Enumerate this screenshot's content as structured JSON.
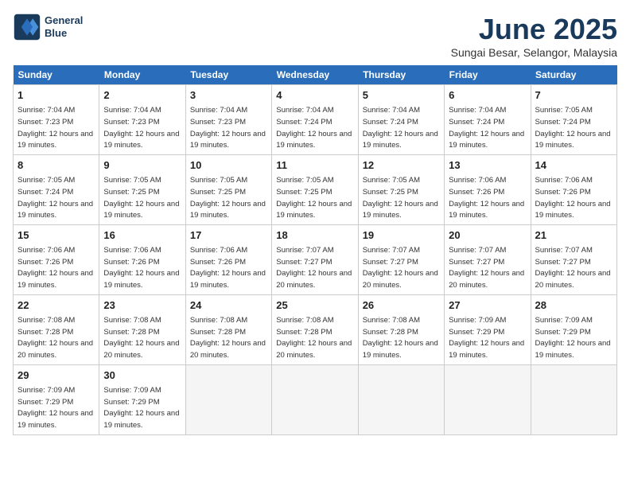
{
  "logo": {
    "line1": "General",
    "line2": "Blue"
  },
  "title": "June 2025",
  "subtitle": "Sungai Besar, Selangor, Malaysia",
  "headers": [
    "Sunday",
    "Monday",
    "Tuesday",
    "Wednesday",
    "Thursday",
    "Friday",
    "Saturday"
  ],
  "weeks": [
    [
      {
        "day": "1",
        "sunrise": "7:04 AM",
        "sunset": "7:23 PM",
        "daylight": "12 hours and 19 minutes."
      },
      {
        "day": "2",
        "sunrise": "7:04 AM",
        "sunset": "7:23 PM",
        "daylight": "12 hours and 19 minutes."
      },
      {
        "day": "3",
        "sunrise": "7:04 AM",
        "sunset": "7:23 PM",
        "daylight": "12 hours and 19 minutes."
      },
      {
        "day": "4",
        "sunrise": "7:04 AM",
        "sunset": "7:24 PM",
        "daylight": "12 hours and 19 minutes."
      },
      {
        "day": "5",
        "sunrise": "7:04 AM",
        "sunset": "7:24 PM",
        "daylight": "12 hours and 19 minutes."
      },
      {
        "day": "6",
        "sunrise": "7:04 AM",
        "sunset": "7:24 PM",
        "daylight": "12 hours and 19 minutes."
      },
      {
        "day": "7",
        "sunrise": "7:05 AM",
        "sunset": "7:24 PM",
        "daylight": "12 hours and 19 minutes."
      }
    ],
    [
      {
        "day": "8",
        "sunrise": "7:05 AM",
        "sunset": "7:24 PM",
        "daylight": "12 hours and 19 minutes."
      },
      {
        "day": "9",
        "sunrise": "7:05 AM",
        "sunset": "7:25 PM",
        "daylight": "12 hours and 19 minutes."
      },
      {
        "day": "10",
        "sunrise": "7:05 AM",
        "sunset": "7:25 PM",
        "daylight": "12 hours and 19 minutes."
      },
      {
        "day": "11",
        "sunrise": "7:05 AM",
        "sunset": "7:25 PM",
        "daylight": "12 hours and 19 minutes."
      },
      {
        "day": "12",
        "sunrise": "7:05 AM",
        "sunset": "7:25 PM",
        "daylight": "12 hours and 19 minutes."
      },
      {
        "day": "13",
        "sunrise": "7:06 AM",
        "sunset": "7:26 PM",
        "daylight": "12 hours and 19 minutes."
      },
      {
        "day": "14",
        "sunrise": "7:06 AM",
        "sunset": "7:26 PM",
        "daylight": "12 hours and 19 minutes."
      }
    ],
    [
      {
        "day": "15",
        "sunrise": "7:06 AM",
        "sunset": "7:26 PM",
        "daylight": "12 hours and 19 minutes."
      },
      {
        "day": "16",
        "sunrise": "7:06 AM",
        "sunset": "7:26 PM",
        "daylight": "12 hours and 19 minutes."
      },
      {
        "day": "17",
        "sunrise": "7:06 AM",
        "sunset": "7:26 PM",
        "daylight": "12 hours and 19 minutes."
      },
      {
        "day": "18",
        "sunrise": "7:07 AM",
        "sunset": "7:27 PM",
        "daylight": "12 hours and 20 minutes."
      },
      {
        "day": "19",
        "sunrise": "7:07 AM",
        "sunset": "7:27 PM",
        "daylight": "12 hours and 20 minutes."
      },
      {
        "day": "20",
        "sunrise": "7:07 AM",
        "sunset": "7:27 PM",
        "daylight": "12 hours and 20 minutes."
      },
      {
        "day": "21",
        "sunrise": "7:07 AM",
        "sunset": "7:27 PM",
        "daylight": "12 hours and 20 minutes."
      }
    ],
    [
      {
        "day": "22",
        "sunrise": "7:08 AM",
        "sunset": "7:28 PM",
        "daylight": "12 hours and 20 minutes."
      },
      {
        "day": "23",
        "sunrise": "7:08 AM",
        "sunset": "7:28 PM",
        "daylight": "12 hours and 20 minutes."
      },
      {
        "day": "24",
        "sunrise": "7:08 AM",
        "sunset": "7:28 PM",
        "daylight": "12 hours and 20 minutes."
      },
      {
        "day": "25",
        "sunrise": "7:08 AM",
        "sunset": "7:28 PM",
        "daylight": "12 hours and 20 minutes."
      },
      {
        "day": "26",
        "sunrise": "7:08 AM",
        "sunset": "7:28 PM",
        "daylight": "12 hours and 19 minutes."
      },
      {
        "day": "27",
        "sunrise": "7:09 AM",
        "sunset": "7:29 PM",
        "daylight": "12 hours and 19 minutes."
      },
      {
        "day": "28",
        "sunrise": "7:09 AM",
        "sunset": "7:29 PM",
        "daylight": "12 hours and 19 minutes."
      }
    ],
    [
      {
        "day": "29",
        "sunrise": "7:09 AM",
        "sunset": "7:29 PM",
        "daylight": "12 hours and 19 minutes."
      },
      {
        "day": "30",
        "sunrise": "7:09 AM",
        "sunset": "7:29 PM",
        "daylight": "12 hours and 19 minutes."
      },
      null,
      null,
      null,
      null,
      null
    ]
  ]
}
